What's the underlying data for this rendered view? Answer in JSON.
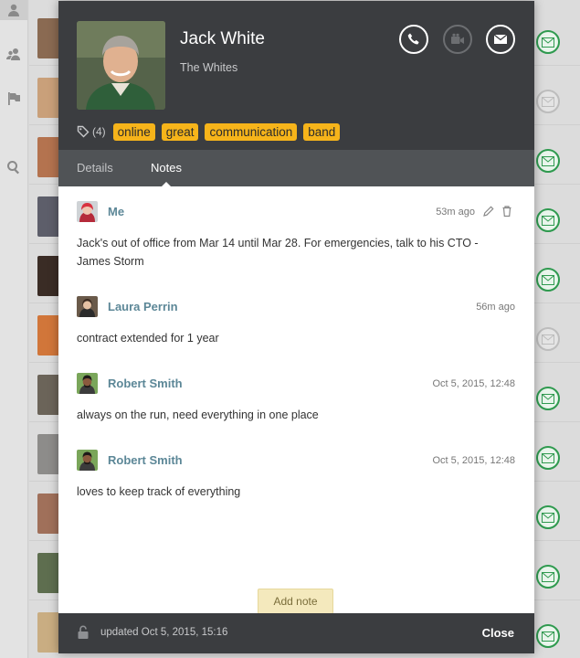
{
  "contact": {
    "name": "Jack White",
    "company": "The Whites",
    "tag_count": "(4)",
    "tags": [
      "online",
      "great",
      "communication",
      "band"
    ]
  },
  "tabs": {
    "details": "Details",
    "notes": "Notes"
  },
  "notes": [
    {
      "author": "Me",
      "time": "53m ago",
      "text": "Jack's out of office from Mar 14 until Mar 28. For emergencies, talk to his CTO - James Storm"
    },
    {
      "author": "Laura Perrin",
      "time": "56m ago",
      "text": "contract extended for 1 year"
    },
    {
      "author": "Robert Smith",
      "time": "Oct 5, 2015, 12:48",
      "text": "always on the run, need everything in one place"
    },
    {
      "author": "Robert Smith",
      "time": "Oct 5, 2015, 12:48",
      "text": "loves to keep track of everything"
    }
  ],
  "add_note_label": "Add note",
  "footer": {
    "updated": "updated  Oct 5, 2015, 15:16",
    "close": "Close"
  },
  "icons": {
    "call": "phone-icon",
    "video": "video-camera-icon",
    "email": "envelope-icon",
    "tag": "tag-icon",
    "edit": "pencil-icon",
    "delete": "trash-icon",
    "lock": "lock-icon"
  },
  "colors": {
    "tag": "#f6b41a",
    "header": "#3b3d40",
    "author": "#5c8797",
    "mail_badge": "#2f9a4f"
  }
}
